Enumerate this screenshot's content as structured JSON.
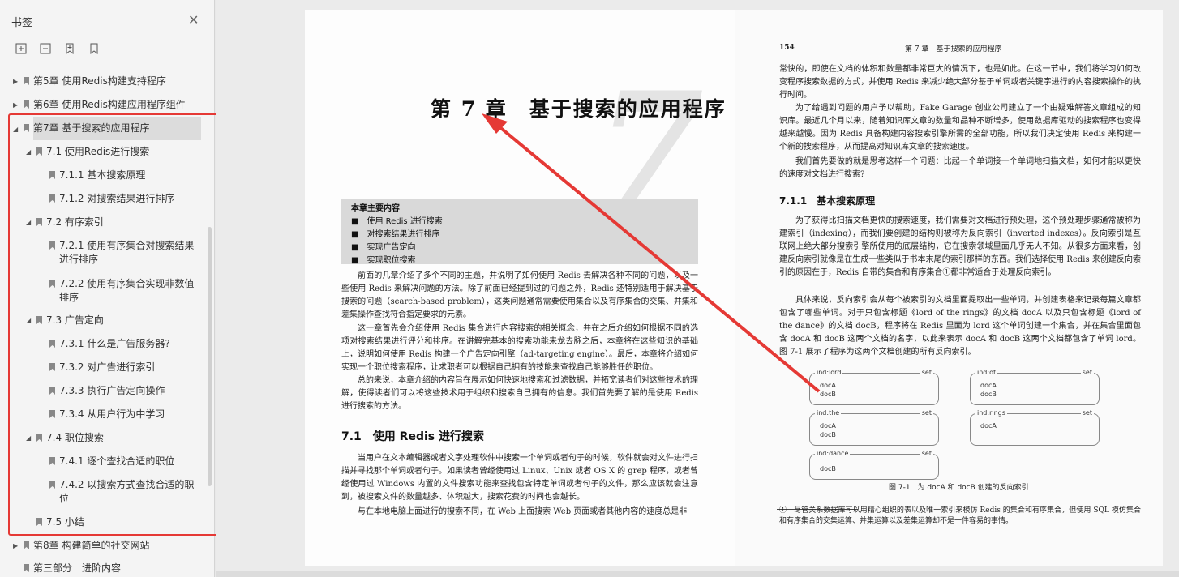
{
  "sidebar": {
    "title": "书签",
    "toc": [
      {
        "label": "第5章 使用Redis构建支持程序",
        "arrow": "▶"
      },
      {
        "label": "第6章 使用Redis构建应用程序组件",
        "arrow": "▶"
      },
      {
        "label": "第7章 基于搜索的应用程序",
        "arrow": "◢"
      },
      {
        "label": "7.1 使用Redis进行搜索",
        "arrow": "◢"
      },
      {
        "label": "7.1.1 基本搜索原理"
      },
      {
        "label": "7.1.2 对搜索结果进行排序"
      },
      {
        "label": "7.2 有序索引",
        "arrow": "◢"
      },
      {
        "label": "7.2.1 使用有序集合对搜索结果",
        "label2": "进行排序"
      },
      {
        "label": "7.2.2 使用有序集合实现非数值",
        "label2": "排序"
      },
      {
        "label": "7.3 广告定向",
        "arrow": "◢"
      },
      {
        "label": "7.3.1 什么是广告服务器?"
      },
      {
        "label": "7.3.2 对广告进行索引"
      },
      {
        "label": "7.3.3 执行广告定向操作"
      },
      {
        "label": "7.3.4 从用户行为中学习"
      },
      {
        "label": "7.4 职位搜索",
        "arrow": "◢"
      },
      {
        "label": "7.4.1 逐个查找合适的职位"
      },
      {
        "label": "7.4.2 以搜索方式查找合适的职",
        "label2": "位"
      },
      {
        "label": "7.5 小结"
      },
      {
        "label": "第8章 构建简单的社交网站",
        "arrow": "▶"
      },
      {
        "label": "第三部分　进阶内容"
      }
    ]
  },
  "left_page": {
    "chapter_title": "第 7 章　基于搜索的应用程序",
    "big_number": "7",
    "summary_head": "本章主要内容",
    "summary_items": [
      "■　使用 Redis 进行搜索",
      "■　对搜索结果进行排序",
      "■　实现广告定向",
      "■　实现职位搜索"
    ],
    "para1": "前面的几章介绍了多个不同的主题，并说明了如何使用 Redis 去解决各种不同的问题，以及一些使用 Redis 来解决问题的方法。除了前面已经提到过的问题之外，Redis 还特别适用于解决基于搜索的问题（search-based problem），这类问题通常需要使用集合以及有序集合的交集、并集和差集操作查找符合指定要求的元素。",
    "para2": "这一章首先会介绍使用 Redis 集合进行内容搜索的相关概念，并在之后介绍如何根据不同的选项对搜索结果进行评分和排序。在讲解完基本的搜索功能来龙去脉之后，本章将在这些知识的基础上，说明如何使用 Redis 构建一个广告定向引擎（ad-targeting engine）。最后，本章将介绍如何实现一个职位搜索程序，让求职者可以根据自己拥有的技能来查找自己能够胜任的职位。",
    "para3": "总的来说，本章介绍的内容旨在展示如何快速地搜索和过滤数据，并拓宽读者们对这些技术的理解，使得读者们可以将这些技术用于组织和搜索自己拥有的信息。我们首先要了解的是使用 Redis 进行搜索的方法。",
    "sec_title": "7.1　使用 Redis 进行搜索",
    "para4": "当用户在文本编辑器或者文字处理软件中搜索一个单词或者句子的时候，软件就会对文件进行扫描并寻找那个单词或者句子。如果读者曾经使用过 Linux、Unix 或者 OS X 的 grep 程序，或者曾经使用过 Windows 内置的文件搜索功能来查找包含特定单词或者句子的文件，那么应该就会注意到，被搜索文件的数量越多、体积越大，搜索花费的时间也会越长。",
    "para5": "与在本地电脑上面进行的搜索不同，在 Web 上面搜索 Web 页面或者其他内容的速度总是非"
  },
  "right_page": {
    "page_no": "154",
    "running_head": "第 7 章　基于搜索的应用程序",
    "para1": "常快的，即使在文档的体积和数量都非常巨大的情况下，也是如此。在这一节中，我们将学习如何改变程序搜索数据的方式，并使用 Redis 来减少绝大部分基于单词或者关键字进行的内容搜索操作的执行时间。",
    "para2": "为了给遇到问题的用户予以帮助，Fake Garage 创业公司建立了一个由疑难解答文章组成的知识库。最近几个月以来，随着知识库文章的数量和品种不断增多，使用数据库驱动的搜索程序也变得越来越慢。因为 Redis 具备构建内容搜索引擎所需的全部功能，所以我们决定使用 Redis 来构建一个新的搜索程序，从而提高对知识库文章的搜索速度。",
    "para3": "我们首先要做的就是思考这样一个问题：比起一个单词接一个单词地扫描文档，如何才能以更快的速度对文档进行搜索?",
    "sec_title": "7.1.1　基本搜索原理",
    "para4": "为了获得比扫描文档更快的搜索速度，我们需要对文档进行预处理，这个预处理步骤通常被称为建索引（indexing），而我们要创建的结构则被称为反向索引（inverted indexes）。反向索引是互联网上绝大部分搜索引擎所使用的底层结构，它在搜索领域里面几乎无人不知。从很多方面来看，创建反向索引就像是在生成一些类似于书本末尾的索引那样的东西。我们选择使用 Redis 来创建反向索引的原因在于，Redis 自带的集合和有序集合①都非常适合于处理反向索引。",
    "para5": "具体来说，反向索引会从每个被索引的文档里面提取出一些单词，并创建表格来记录每篇文章都包含了哪些单词。对于只包含标题《lord of the rings》的文档 docA 以及只包含标题《lord of the dance》的文档 docB，程序将在 Redis 里面为 lord 这个单词创建一个集合，并在集合里面包含 docA 和 docB 这两个文档的名字，以此来表示 docA 和 docB 这两个文档都包含了单词 lord。图 7-1 展示了程序为这两个文档创建的所有反向索引。",
    "figure": [
      {
        "key": "ind:lord",
        "type": "set",
        "members": [
          "docA",
          "docB"
        ]
      },
      {
        "key": "ind:of",
        "type": "set",
        "members": [
          "docA",
          "docB"
        ]
      },
      {
        "key": "ind:the",
        "type": "set",
        "members": [
          "docA",
          "docB"
        ]
      },
      {
        "key": "ind:rings",
        "type": "set",
        "members": [
          "docA"
        ]
      },
      {
        "key": "ind:dance",
        "type": "set",
        "members": [
          "docB"
        ]
      }
    ],
    "fig_caption": "图 7-1　为 docA 和 docB 创建的反向索引",
    "footnote": "①　尽管关系数据库可以用精心组织的表以及唯一索引来模仿 Redis 的集合和有序集合，但使用 SQL 模仿集合和有序集合的交集运算、并集运算以及差集运算却不是一件容易的事情。"
  },
  "colors": {
    "highlight": "#e53935"
  }
}
